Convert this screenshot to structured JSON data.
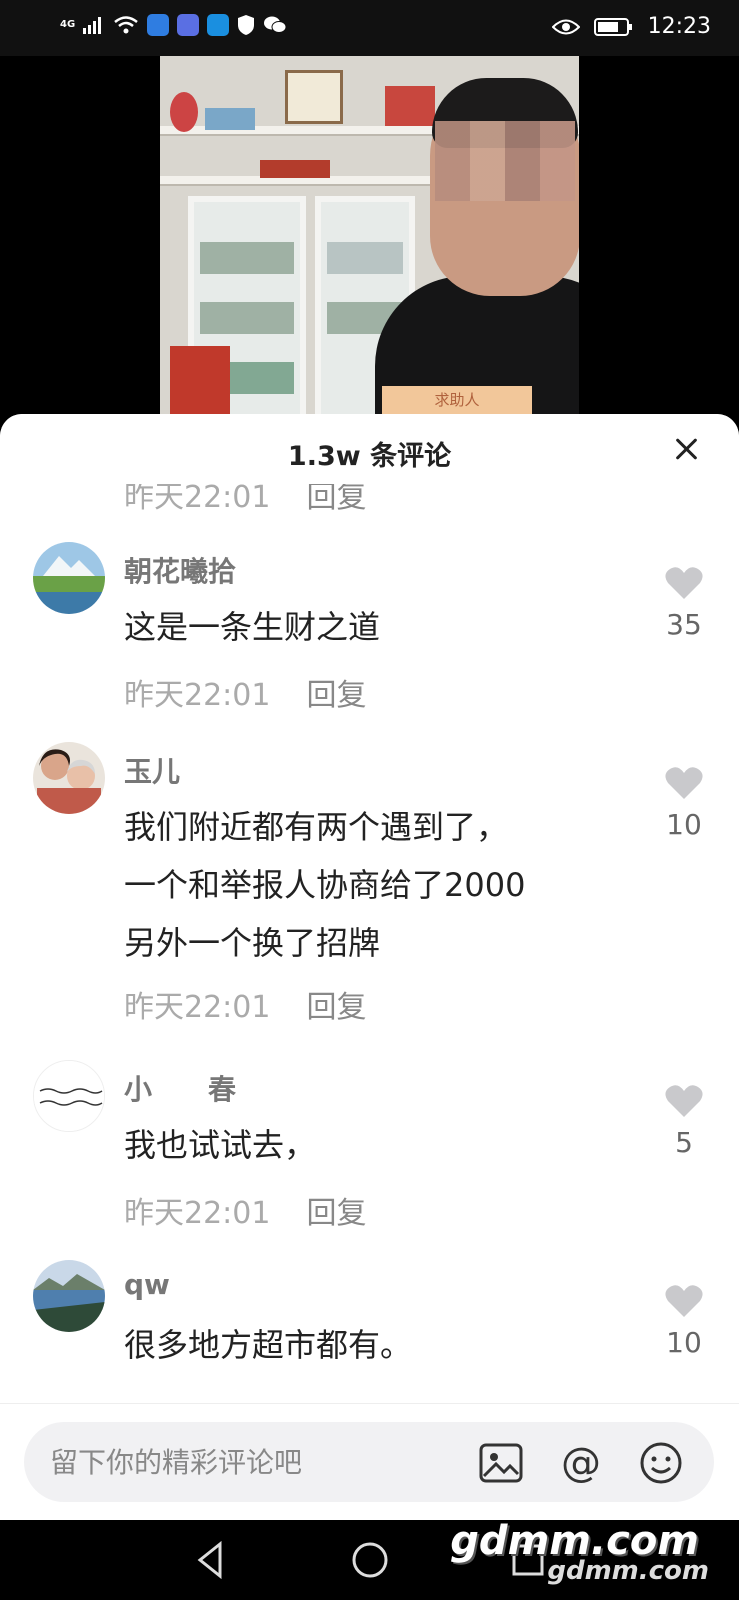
{
  "status_bar": {
    "network": "4G",
    "time": "12:23"
  },
  "video": {
    "sign_text": "求助人"
  },
  "sheet": {
    "title": "1.3w 条评论",
    "partial_comment": {
      "time": "昨天22:01",
      "reply": "回复"
    },
    "comments": [
      {
        "name": "朝花曦拾",
        "text": "这是一条生财之道",
        "time": "昨天22:01",
        "reply": "回复",
        "likes": "35"
      },
      {
        "name": "玉儿",
        "text": "我们附近都有两个遇到了，\n一个和举报人协商给了2000\n另外一个换了招牌",
        "time": "昨天22:01",
        "reply": "回复",
        "likes": "10"
      },
      {
        "name": "小　　春",
        "text": "我也试试去，",
        "time": "昨天22:01",
        "reply": "回复",
        "likes": "5"
      },
      {
        "name": "qw",
        "text": "很多地方超市都有。",
        "likes": "10"
      }
    ]
  },
  "input_bar": {
    "placeholder": "留下你的精彩评论吧"
  },
  "watermark": {
    "main": "gdmm.com",
    "sub": "gdmm.com"
  },
  "colors": {
    "accent_like": "#c9c9cc",
    "sheet_bg": "#ffffff"
  }
}
